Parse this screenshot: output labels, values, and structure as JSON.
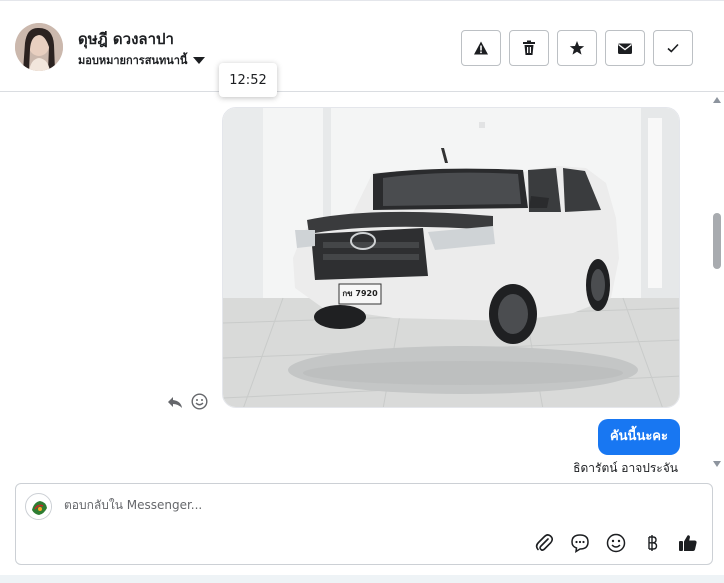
{
  "header": {
    "contact_name": "ดุษฎี ดวงลาปา",
    "assign_label": "มอบหมายการสนทนานี้",
    "actions": [
      {
        "name": "report-button",
        "icon": "warning-icon"
      },
      {
        "name": "delete-button",
        "icon": "trash-icon"
      },
      {
        "name": "star-button",
        "icon": "star-icon"
      },
      {
        "name": "mark-unread-button",
        "icon": "envelope-icon"
      },
      {
        "name": "mark-done-button",
        "icon": "check-icon"
      }
    ]
  },
  "tooltip": {
    "time": "12:52"
  },
  "thread": {
    "image_plate": "กข 7920",
    "outgoing_message": "คันนี้นะคะ",
    "sender_name": "ธิดารัตน์ อาจประจัน"
  },
  "composer": {
    "placeholder": "ตอบกลับใน Messenger..."
  },
  "colors": {
    "accent": "#1877f2",
    "border": "#dadde1"
  }
}
